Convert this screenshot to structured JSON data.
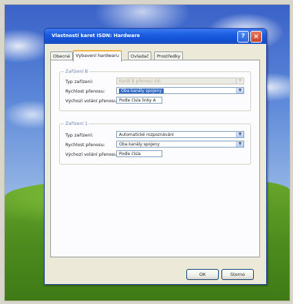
{
  "window": {
    "title": "Vlastnosti karet ISDN: Hardware"
  },
  "tabs": [
    {
      "label": "Obecné"
    },
    {
      "label": "Vybavení hardwaru"
    },
    {
      "label": "Ovladač"
    },
    {
      "label": "Prostředky"
    }
  ],
  "group_b": {
    "title": "Zařízení B",
    "rows": [
      {
        "label": "Typ zařízení:",
        "value": "Kanál B přenosu dat"
      },
      {
        "label": "Rychlost přenosu:",
        "value": "Oba kanály spojeny"
      },
      {
        "label": "Výchozí volání přenosu:",
        "value": "Podle čísla linky A"
      }
    ]
  },
  "group_1": {
    "title": "Zařízení 1",
    "rows": [
      {
        "label": "Typ zařízení:",
        "value": "Automatické rozpoznávání"
      },
      {
        "label": "Rychlost přenosu:",
        "value": "Oba kanály spojeny"
      },
      {
        "label": "Výchozí volání přenosu:",
        "value": "Podle čísla"
      }
    ]
  },
  "buttons": {
    "ok": "OK",
    "cancel": "Storno"
  }
}
